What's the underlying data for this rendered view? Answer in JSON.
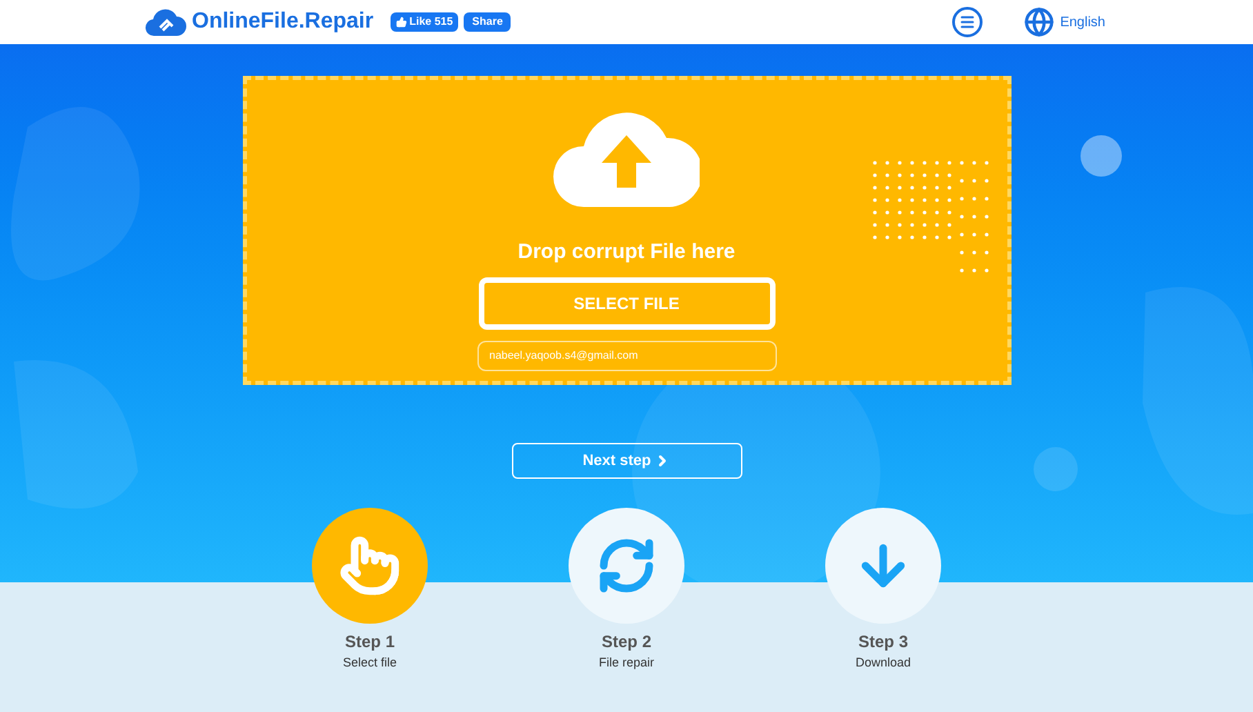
{
  "header": {
    "logo": "OnlineFile.Repair",
    "like_button": "Like 515",
    "share_button": "Share",
    "language": "English"
  },
  "upload": {
    "title": "Drop corrupt File here",
    "select_button": "SELECT FILE",
    "email": "nabeel.yaqoob.s4@gmail.com"
  },
  "next_button": "Next step",
  "steps": [
    {
      "kind": "select",
      "title": "Step 1",
      "caption": "Select file",
      "selected": true
    },
    {
      "kind": "repair",
      "title": "Step 2",
      "caption": "File repair",
      "selected": false
    },
    {
      "kind": "download",
      "title": "Step 3",
      "caption": "Download",
      "selected": false
    }
  ]
}
